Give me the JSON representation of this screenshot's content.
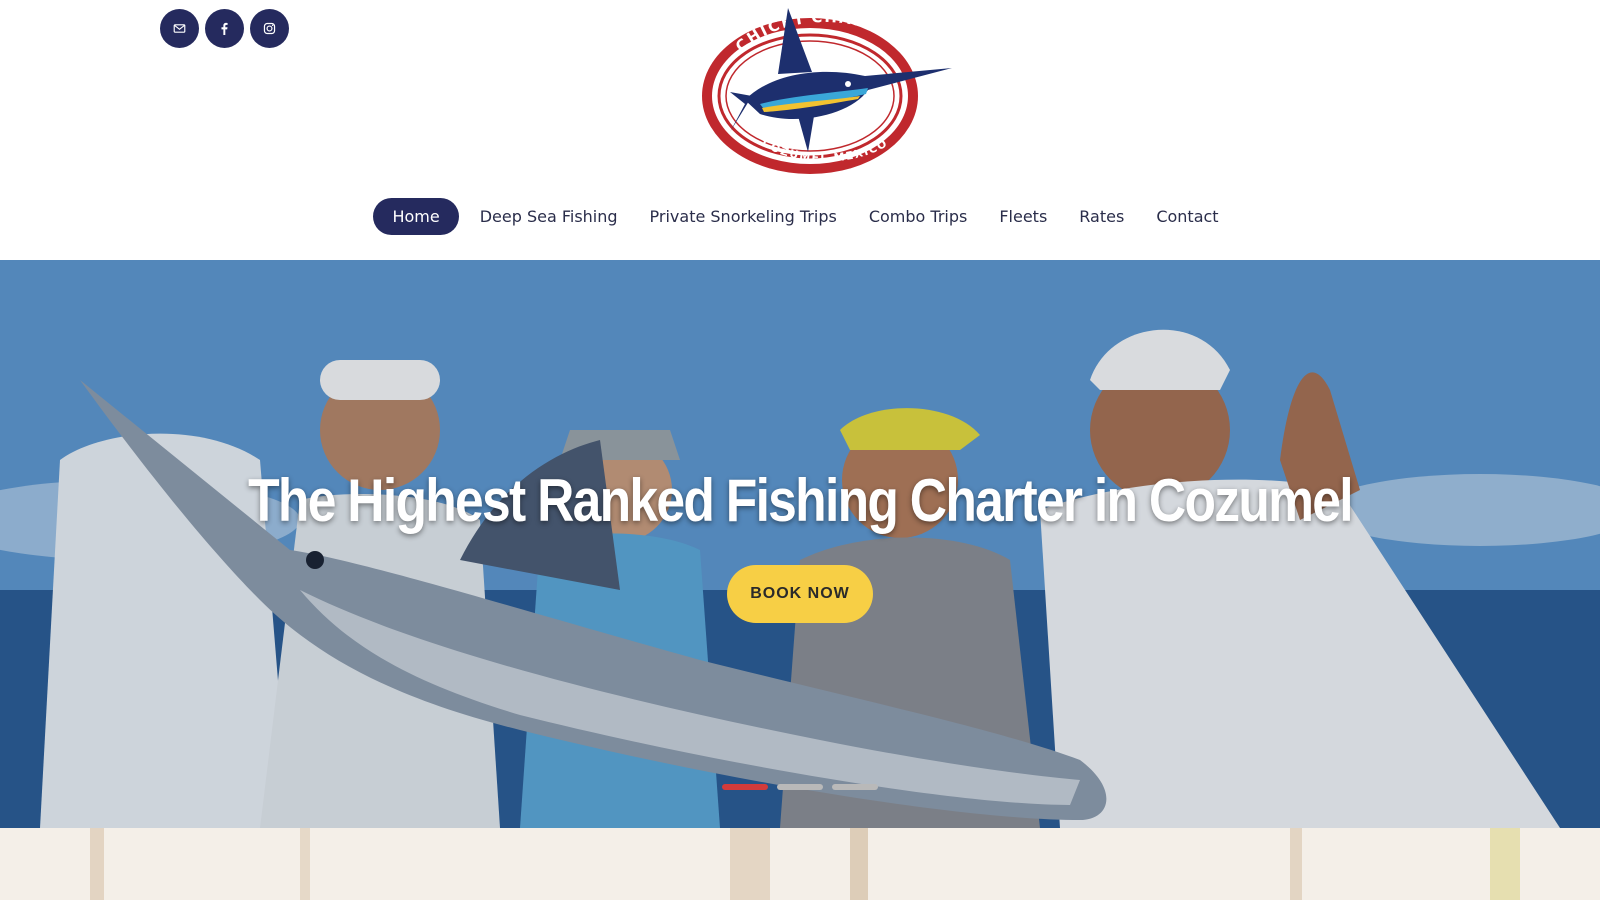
{
  "social": {
    "items": [
      {
        "icon": "email-icon"
      },
      {
        "icon": "facebook-icon"
      },
      {
        "icon": "instagram-icon"
      }
    ],
    "color": "#252a5e"
  },
  "logo": {
    "top_text": "CHICHI CHARTERS",
    "bottom_text": "COZUMEL MEXICO",
    "colors": {
      "ring": "#c0282d",
      "fish": "#1d2f6e",
      "accent": "#3aa7d8",
      "yellow": "#f2c230"
    }
  },
  "nav": {
    "items": [
      {
        "label": "Home",
        "active": true
      },
      {
        "label": "Deep Sea Fishing"
      },
      {
        "label": "Private Snorkeling Trips"
      },
      {
        "label": "Combo Trips"
      },
      {
        "label": "Fleets"
      },
      {
        "label": "Rates"
      },
      {
        "label": "Contact"
      }
    ],
    "active_bg": "#252a5e"
  },
  "hero": {
    "title": "The Highest Ranked Fishing Charter in Cozumel",
    "cta": "BOOK NOW",
    "slides": 3,
    "active_slide": 1,
    "colors": {
      "cta": "#f7cf45",
      "active_dot": "#d23b3b",
      "dot": "#b9b9b9"
    }
  }
}
